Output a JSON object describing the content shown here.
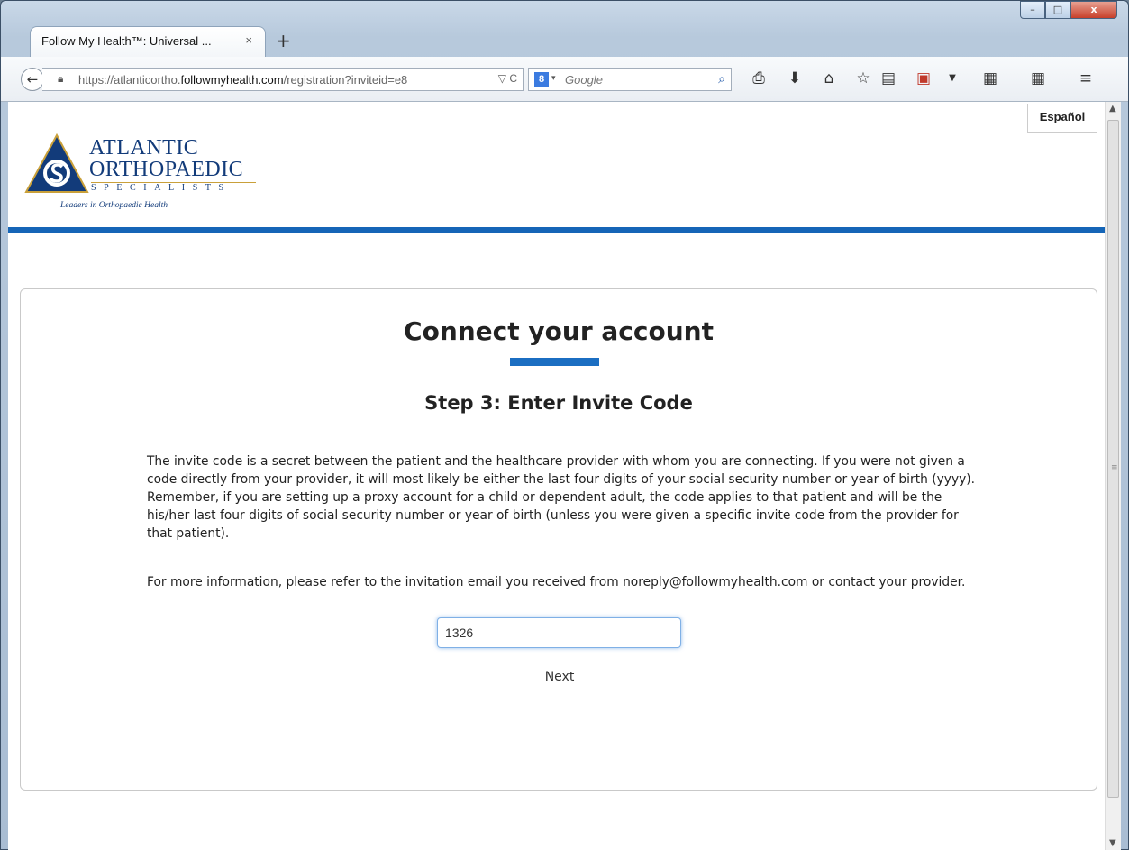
{
  "browser": {
    "tab_title": "Follow My Health™: Universal ...",
    "tab_close": "×",
    "new_tab": "+",
    "window_controls": {
      "minimize": "–",
      "maximize": "□",
      "close": "x"
    },
    "url_prefix": "https://atlanticortho.",
    "url_host": "followmyhealth.com",
    "url_path": "/registration?inviteid=e8",
    "search_engine_glyph": "8",
    "search_placeholder": "Google",
    "toolbar_icons": [
      "print-icon",
      "download-icon",
      "home-icon",
      "bookmark-star-icon",
      "reading-list-icon",
      "pdf-icon",
      "dropdown-icon",
      "qr-code-icon",
      "qr-code-icon",
      "menu-icon"
    ]
  },
  "page": {
    "language_button": "Español",
    "logo": {
      "line1": "ATLANTIC",
      "line2": "ORTHOPAEDIC",
      "line3": "SPECIALISTS",
      "tagline": "Leaders in Orthopaedic Health"
    },
    "card": {
      "title": "Connect your account",
      "step_title": "Step 3: Enter Invite Code",
      "instructions": "The invite code is a secret between the patient and the healthcare provider with whom you are connecting.  If you were not given a code directly from your provider, it will most likely be either the last four digits of your social security number or year of birth (yyyy).  Remember, if you are setting up a proxy account for a child or dependent adult, the code applies to that patient and will be the his/her last four digits of social security number or year of birth (unless you were given a specific invite code from the provider for that patient).",
      "more_info": "For more information, please refer to the invitation email you received from noreply@followmyhealth.com or contact your provider.",
      "invite_code_value": "1326",
      "next_label": "Next"
    }
  },
  "colors": {
    "header_rule": "#1565b7",
    "title_accent": "#1b6ec2",
    "logo_navy": "#123b7a",
    "logo_gold": "#c9a03a"
  }
}
